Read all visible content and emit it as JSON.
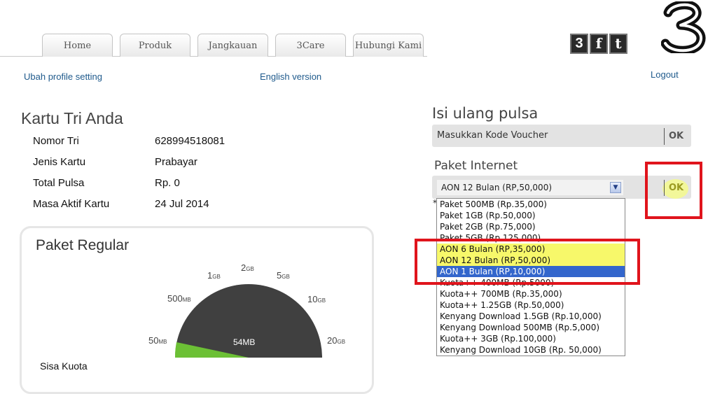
{
  "nav": {
    "tabs": [
      "Home",
      "Produk",
      "Jangkauan",
      "3Care",
      "Hubungi Kami"
    ],
    "social": [
      "3",
      "f",
      "t"
    ],
    "logo_text": "3"
  },
  "links": {
    "profile": "Ubah profile setting",
    "english": "English version",
    "logout": "Logout"
  },
  "card": {
    "title": "Kartu Tri Anda",
    "rows": [
      {
        "label": "Nomor Tri",
        "value": "628994518081"
      },
      {
        "label": "Jenis Kartu",
        "value": "Prabayar"
      },
      {
        "label": "Total Pulsa",
        "value": "Rp. 0"
      },
      {
        "label": "Masa Aktif Kartu",
        "value": "24 Jul 2014"
      }
    ]
  },
  "regular": {
    "title": "Paket Regular",
    "gauge": {
      "ticks": [
        {
          "num": "50",
          "unit": "MB"
        },
        {
          "num": "500",
          "unit": "MB"
        },
        {
          "num": "1",
          "unit": "GB"
        },
        {
          "num": "2",
          "unit": "GB"
        },
        {
          "num": "5",
          "unit": "GB"
        },
        {
          "num": "10",
          "unit": "GB"
        },
        {
          "num": "20",
          "unit": "GB"
        }
      ],
      "value_label": "54MB",
      "dial_color": "#404040",
      "fill_color": "#6cc035"
    },
    "sisa_label": "Sisa Kuota"
  },
  "recharge": {
    "title": "Isi ulang pulsa",
    "voucher_placeholder": "Masukkan Kode Voucher",
    "ok": "OK"
  },
  "internet": {
    "title": "Paket Internet",
    "selected": "AON 12 Bulan (RP,50,000)",
    "ok": "OK",
    "note_mark": "*",
    "options": [
      "Paket 500MB (Rp.35,000)",
      "Paket 1GB (Rp.50,000)",
      "Paket 2GB (Rp.75,000)",
      "Paket 5GB (Rp.125,000)",
      "AON 6 Bulan (RP,35,000)",
      "AON 12 Bulan (RP,50,000)",
      "AON 1 Bulan (RP,10,000)",
      "Kuota++ 400MB (Rp.5000)",
      "Kuota++ 700MB (Rp.35,000)",
      "Kuota++ 1.25GB (Rp.50,000)",
      "Kenyang Download 1.5GB (Rp.10,000)",
      "Kenyang Download 500MB (Rp.5,000)",
      "Kuota++ 3GB (Rp.100,000)",
      "Kenyang Download 10GB (Rp. 50,000)"
    ],
    "highlighted_indices": [
      4,
      5
    ],
    "selected_index": 6,
    "annotation_color": "#e0141c",
    "highlight_color": "#f7f86a",
    "selection_color": "#3366cc"
  }
}
